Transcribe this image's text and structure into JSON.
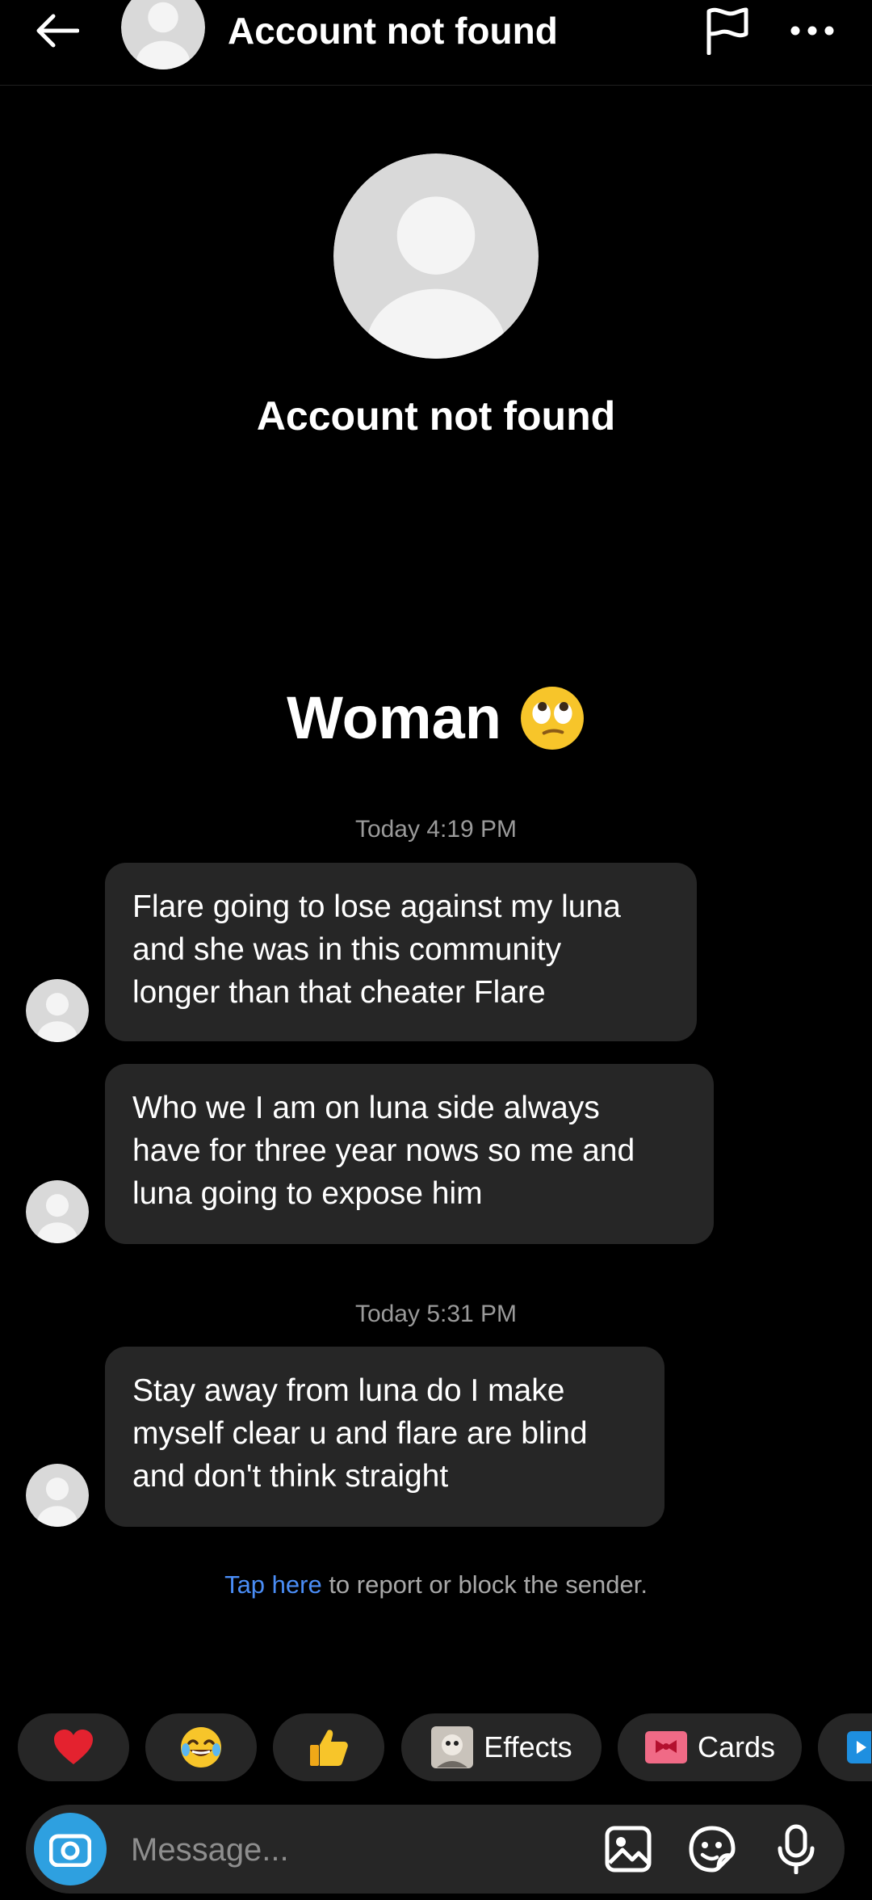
{
  "header": {
    "title": "Account not found"
  },
  "profile": {
    "name": "Account not found"
  },
  "banner": {
    "text": "Woman"
  },
  "threads": [
    {
      "timestamp": "Today 4:19 PM"
    },
    {
      "timestamp": "Today 5:31 PM"
    }
  ],
  "messages": [
    {
      "lines": [
        "Flare going to lose against my luna",
        "and she was in this community",
        "longer than that cheater Flare"
      ]
    },
    {
      "lines": [
        "Who we I am on luna side always",
        "have for three year nows so me and",
        "luna going to expose him"
      ]
    },
    {
      "lines": [
        "Stay away from luna do I make",
        "myself clear u and flare are blind",
        "and don't think straight"
      ]
    }
  ],
  "report": {
    "link": "Tap here",
    "rest": " to report or block the sender."
  },
  "quick_actions": [
    {
      "icon": "heart-icon",
      "label": ""
    },
    {
      "icon": "laughing-emoji-icon",
      "label": ""
    },
    {
      "icon": "thumbs-up-icon",
      "label": ""
    },
    {
      "icon": "effects-icon",
      "label": "Effects"
    },
    {
      "icon": "cards-icon",
      "label": "Cards"
    }
  ],
  "composer": {
    "placeholder": "Message..."
  },
  "colors": {
    "background": "#000000",
    "bubble": "#262626",
    "link": "#4a8df6",
    "camera": "#2ea0e0"
  }
}
